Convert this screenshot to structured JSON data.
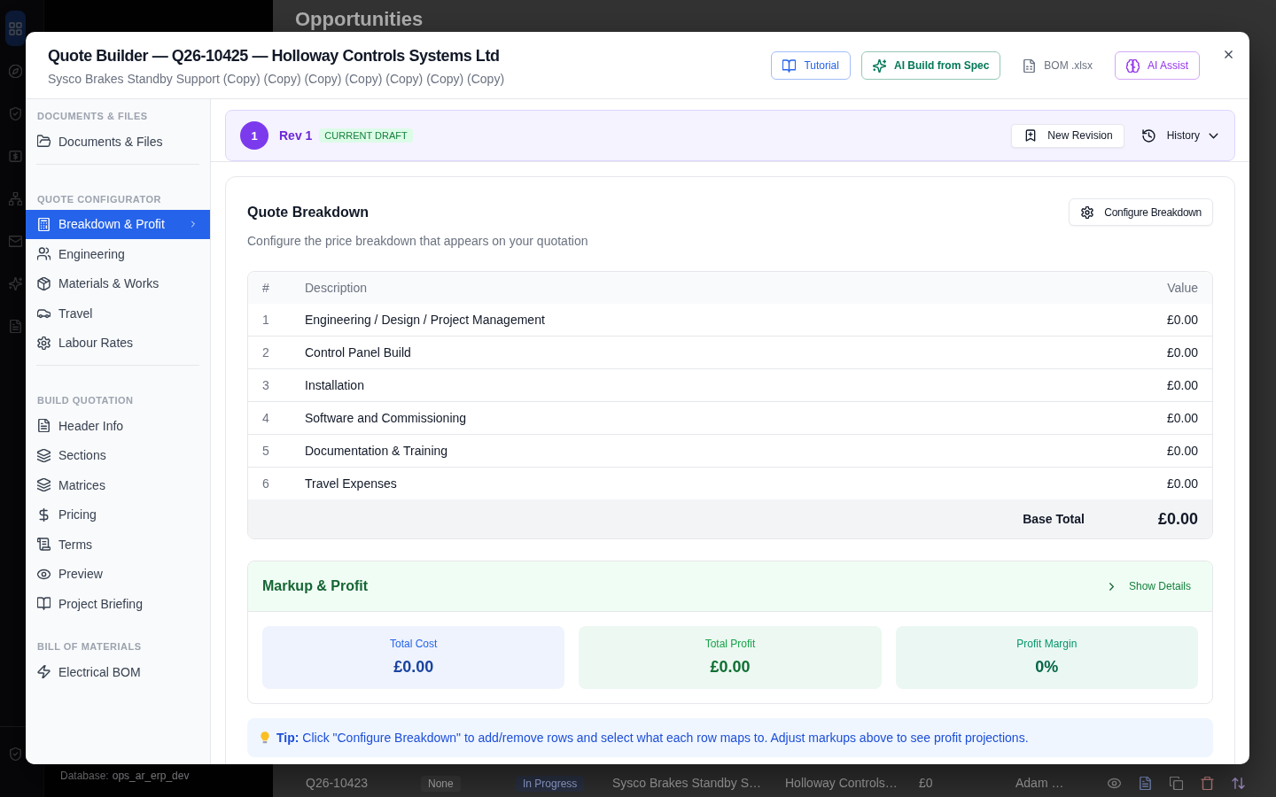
{
  "background_page": {
    "page_title": "Opportunities",
    "nav": [
      {
        "selected": true
      },
      {
        "selected": false
      },
      {
        "selected": false
      },
      {
        "selected": false
      },
      {
        "selected": false
      },
      {
        "selected": false
      },
      {
        "selected": false
      },
      {
        "selected": false
      },
      {
        "selected": false
      }
    ],
    "database": {
      "label": "Database:",
      "value": "ops_ar_erp_dev"
    },
    "row": [
      {
        "kind": "text",
        "text": "Q26-10423"
      },
      {
        "kind": "neutral",
        "text": "None"
      },
      {
        "kind": "info",
        "text": "In Progress"
      },
      {
        "kind": "text",
        "text": "Sysco Brakes Standby S…"
      },
      {
        "kind": "text",
        "text": "Holloway Controls…"
      },
      {
        "kind": "text",
        "text": "£0"
      },
      {
        "kind": "text",
        "text": "Adam …"
      }
    ]
  },
  "modal": {
    "title": "Quote Builder — Q26-10425 — Holloway Controls Systems Ltd",
    "subtitle": "Sysco Brakes Standby Support (Copy) (Copy) (Copy) (Copy) (Copy) (Copy) (Copy)",
    "actions": [
      {
        "label": "Tutorial",
        "kind": "outline",
        "color": "#2563eb"
      },
      {
        "label": "AI Build from Spec",
        "kind": "strong",
        "color": "#047857"
      },
      {
        "label": "BOM .xlsx",
        "kind": "ghost",
        "color": "#6b7280"
      },
      {
        "label": "AI Assist",
        "kind": "outline",
        "color": "#9333ea"
      }
    ]
  },
  "sidebar": {
    "sections": [
      {
        "heading": "DOCUMENTS & FILES",
        "divider": true,
        "items": [
          {
            "label": "Documents & Files",
            "selected": false
          }
        ]
      },
      {
        "heading": "QUOTE CONFIGURATOR",
        "divider": true,
        "items": [
          {
            "label": "Breakdown & Profit",
            "selected": true
          },
          {
            "label": "Engineering",
            "selected": false
          },
          {
            "label": "Materials & Works",
            "selected": false
          },
          {
            "label": "Travel",
            "selected": false
          },
          {
            "label": "Labour Rates",
            "selected": false
          }
        ]
      },
      {
        "heading": "BUILD QUOTATION",
        "divider": false,
        "items": [
          {
            "label": "Header Info",
            "selected": false
          },
          {
            "label": "Sections",
            "selected": false
          },
          {
            "label": "Matrices",
            "selected": false
          },
          {
            "label": "Pricing",
            "selected": false
          },
          {
            "label": "Terms",
            "selected": false
          },
          {
            "label": "Preview",
            "selected": false
          },
          {
            "label": "Project Briefing",
            "selected": false
          }
        ]
      },
      {
        "heading": "BILL OF MATERIALS",
        "divider": false,
        "items": [
          {
            "label": "Electrical BOM",
            "selected": false
          }
        ]
      }
    ]
  },
  "revision": {
    "number": "1",
    "title": "Rev 1",
    "status": "CURRENT DRAFT",
    "new_revision": "New Revision",
    "history": "History"
  },
  "breakdown": {
    "title": "Quote Breakdown",
    "subtitle": "Configure the price breakdown that appears on your quotation",
    "configure_button": "Configure Breakdown",
    "table": {
      "columns": [
        "#",
        "Description",
        "Value"
      ],
      "rows": [
        {
          "number": "1",
          "description": "Engineering / Design / Project Management",
          "value": "£0.00"
        },
        {
          "number": "2",
          "description": "Control Panel Build",
          "value": "£0.00"
        },
        {
          "number": "3",
          "description": "Installation",
          "value": "£0.00"
        },
        {
          "number": "4",
          "description": "Software and Commissioning",
          "value": "£0.00"
        },
        {
          "number": "5",
          "description": "Documentation & Training",
          "value": "£0.00"
        },
        {
          "number": "6",
          "description": "Travel Expenses",
          "value": "£0.00"
        }
      ],
      "total": {
        "label": "Base Total",
        "value": "£0.00"
      }
    }
  },
  "markup": {
    "title": "Markup & Profit",
    "toggle_label": "Show Details",
    "expanded": false,
    "stats": [
      {
        "label": "Total Cost",
        "value": "£0.00",
        "color": "#2563eb"
      },
      {
        "label": "Total Profit",
        "value": "£0.00",
        "color": "#16a34a"
      },
      {
        "label": "Profit Margin",
        "value": "0%",
        "color": "#059669"
      }
    ]
  },
  "tip": {
    "text": "**Tip:** Click \"Configure Breakdown\" to add/remove rows and select what each row maps to. Adjust markups above to see profit projections."
  }
}
